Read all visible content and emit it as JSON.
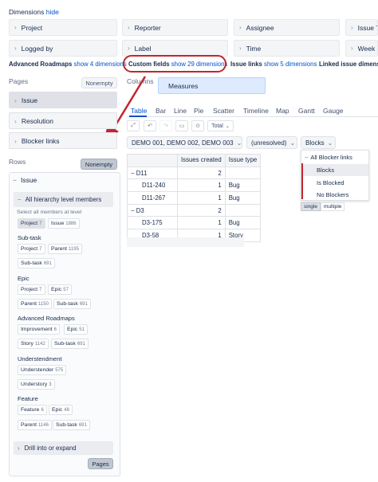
{
  "dimensions": {
    "title": "Dimensions",
    "hide_label": "hide",
    "row1": [
      "Project",
      "Reporter",
      "Assignee",
      "Issue T"
    ],
    "row2": [
      "Logged by",
      "Label",
      "Time",
      "Week D"
    ],
    "groups": [
      {
        "name": "Advanced Roadmaps",
        "link": "show 4 dimensions"
      },
      {
        "name": "Custom fields",
        "link": "show 29 dimensions"
      },
      {
        "name": "Issue links",
        "link": "show 5 dimensions"
      },
      {
        "name": "Linked issue dimensi",
        "link": ""
      }
    ]
  },
  "pages": {
    "label": "Pages",
    "nonempty": "Nonempty",
    "items": [
      "Issue",
      "Resolution",
      "Blocker links"
    ]
  },
  "columns": {
    "label": "Columns",
    "measures": "Measures"
  },
  "rows": {
    "label": "Rows",
    "nonempty": "Nonempty",
    "dimension": "Issue",
    "hierarchy_toggle": "All hierarchy level members",
    "select_hint": "Select all members at level",
    "level_chips": [
      {
        "name": "Project",
        "count": "7"
      },
      {
        "name": "Issue",
        "count": "1886"
      }
    ],
    "groups": [
      {
        "title": "Sub-task",
        "chips": [
          [
            {
              "name": "Project",
              "count": "7"
            },
            {
              "name": "Parent",
              "count": "1195"
            }
          ],
          [
            {
              "name": "Sub-task",
              "count": "691"
            }
          ]
        ]
      },
      {
        "title": "Epic",
        "chips": [
          [
            {
              "name": "Project",
              "count": "7"
            },
            {
              "name": "Epic",
              "count": "57"
            }
          ],
          [
            {
              "name": "Parent",
              "count": "1150"
            },
            {
              "name": "Sub-task",
              "count": "691"
            }
          ]
        ]
      },
      {
        "title": "Advanced Roadmaps",
        "chips": [
          [
            {
              "name": "Improvement",
              "count": "6"
            },
            {
              "name": "Epic",
              "count": "51"
            }
          ],
          [
            {
              "name": "Story",
              "count": "1142"
            },
            {
              "name": "Sub-task",
              "count": "691"
            }
          ]
        ]
      },
      {
        "title": "Understendment",
        "chips": [
          [
            {
              "name": "Understender",
              "count": "575"
            }
          ],
          [
            {
              "name": "Understory",
              "count": "3"
            }
          ]
        ]
      },
      {
        "title": "Feature",
        "chips": [
          [
            {
              "name": "Feature",
              "count": "6"
            },
            {
              "name": "Epic",
              "count": "48"
            }
          ],
          [
            {
              "name": "Parent",
              "count": "1146"
            },
            {
              "name": "Sub-task",
              "count": "691"
            }
          ]
        ]
      }
    ],
    "drill": "Drill into or expand",
    "pages_button": "Pages"
  },
  "view_tabs": [
    "Table",
    "Bar",
    "Line",
    "Pie",
    "Scatter",
    "Timeline",
    "Map",
    "Gantt",
    "Gauge"
  ],
  "toolbar": {
    "total": "Total"
  },
  "filters": {
    "projects": "DEMO 001, DEMO 002, DEMO 003",
    "resolution": "(unresolved)",
    "blockers": "Blocks"
  },
  "dropdown": {
    "items": [
      "All Blocker links",
      "Blocks",
      "Is Blocked",
      "No Blockers"
    ],
    "single": "single",
    "multiple": "multiple"
  },
  "report": {
    "headers": [
      "Issues created",
      "Issue type"
    ],
    "rows": [
      {
        "label": "D11",
        "prefix": "−",
        "created": "2",
        "type": ""
      },
      {
        "label": "D11-240",
        "prefix": "",
        "created": "1",
        "type": "Bug"
      },
      {
        "label": "D11-267",
        "prefix": "",
        "created": "1",
        "type": "Bug"
      },
      {
        "label": "D3",
        "prefix": "−",
        "created": "2",
        "type": ""
      },
      {
        "label": "D3-175",
        "prefix": "",
        "created": "1",
        "type": "Bug"
      },
      {
        "label": "D3-58",
        "prefix": "",
        "created": "1",
        "type": "Story"
      }
    ]
  },
  "colors": {
    "accent": "#0052cc",
    "annotation": "#c1272d",
    "measures_bg": "#deebff"
  }
}
